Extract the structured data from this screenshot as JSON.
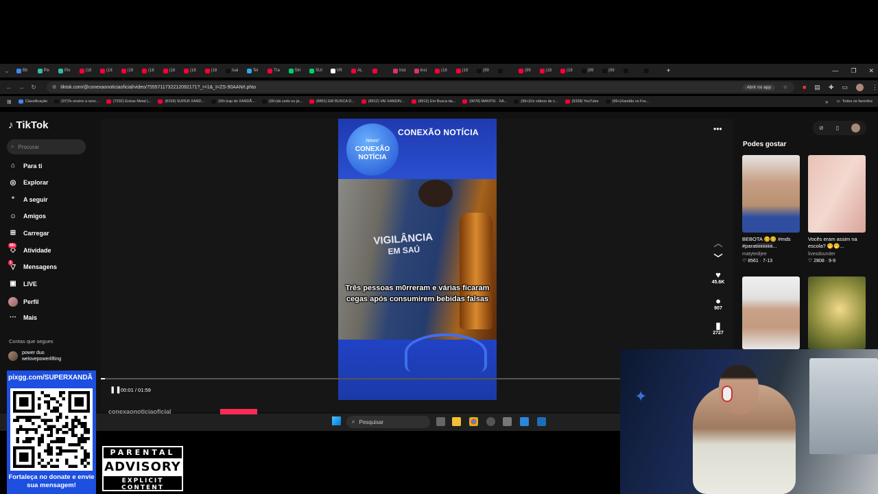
{
  "browser": {
    "tabs": [
      {
        "label": "Bit",
        "color": "#4285f4"
      },
      {
        "label": "Pix",
        "color": "#32bcad"
      },
      {
        "label": "Pix",
        "color": "#32bcad"
      },
      {
        "label": "(18",
        "color": "#ff0033"
      },
      {
        "label": "(18",
        "color": "#ff0033"
      },
      {
        "label": "(18",
        "color": "#ff0033"
      },
      {
        "label": "(18",
        "color": "#ff0033"
      },
      {
        "label": "(18",
        "color": "#ff0033"
      },
      {
        "label": "(18",
        "color": "#ff0033"
      },
      {
        "label": "(18",
        "color": "#ff0033"
      },
      {
        "label": "Isai",
        "color": "#111111"
      },
      {
        "label": "Tel",
        "color": "#2aabee"
      },
      {
        "label": "Tra",
        "color": "#ff0033"
      },
      {
        "label": "Stri",
        "color": "#00d26a"
      },
      {
        "label": "SUI",
        "color": "#00d26a"
      },
      {
        "label": "VR",
        "color": "#ffffff"
      },
      {
        "label": "AL",
        "color": "#ff0033"
      },
      {
        "label": "",
        "color": "#ff0033"
      },
      {
        "label": "Inst",
        "color": "#e1306c"
      },
      {
        "label": "Inst",
        "color": "#e1306c"
      },
      {
        "label": "(18",
        "color": "#ff0033"
      },
      {
        "label": "(18",
        "color": "#ff0033"
      },
      {
        "label": "(99",
        "color": "#111111"
      },
      {
        "label": "",
        "color": "#111111"
      },
      {
        "label": "(99",
        "color": "#ff0033"
      },
      {
        "label": "(18",
        "color": "#ff0033"
      },
      {
        "label": "(18",
        "color": "#ff0033"
      },
      {
        "label": "(99",
        "color": "#111111"
      },
      {
        "label": "(99",
        "color": "#111111"
      },
      {
        "label": "",
        "color": "#111111"
      },
      {
        "label": "",
        "color": "#111111"
      }
    ],
    "url": "tiktok.com/@conexaonoticiaoficial/video/7555711732212092171?_r=1&_t=ZS-90AANrl.phto",
    "open_app": "Abrir no app",
    "bookmarks": [
      {
        "label": "Classificação",
        "color": "#4285f4"
      },
      {
        "label": "(97)Te ensino a venc...",
        "color": "#111111"
      },
      {
        "label": "(7292) Enéas Metal |...",
        "color": "#ff0033"
      },
      {
        "label": "(8159) SUPER XAND...",
        "color": "#ff0033"
      },
      {
        "label": "(99+)rap do XANDÃ...",
        "color": "#111111"
      },
      {
        "label": "(99+)tá cedo ou já...",
        "color": "#111111"
      },
      {
        "label": "(8851) EM BUSCA D...",
        "color": "#ff0033"
      },
      {
        "label": "(8912) VAI XANDIN...",
        "color": "#ff0033"
      },
      {
        "label": "(8912) Em Busca da...",
        "color": "#ff0033"
      },
      {
        "label": "(9078) MANTIS · XA...",
        "color": "#ff0033"
      },
      {
        "label": "(99+)Os vídeos de c...",
        "color": "#111111"
      },
      {
        "label": "(9338) YouTube",
        "color": "#ff0033"
      },
      {
        "label": "(99+)Xandão vs Fra...",
        "color": "#111111"
      }
    ],
    "all_favorites": "Todos os favoritos"
  },
  "tiktok": {
    "brand": "TikTok",
    "search_placeholder": "Procurar",
    "nav": [
      {
        "label": "Para ti",
        "icon": "home-icon"
      },
      {
        "label": "Explorar",
        "icon": "compass-icon"
      },
      {
        "label": "A seguir",
        "icon": "person-plus-icon"
      },
      {
        "label": "Amigos",
        "icon": "friends-icon"
      },
      {
        "label": "Carregar",
        "icon": "upload-icon"
      },
      {
        "label": "Atividade",
        "icon": "activity-icon",
        "badge": "99+"
      },
      {
        "label": "Mensagens",
        "icon": "message-icon",
        "badge": "1"
      },
      {
        "label": "LIVE",
        "icon": "live-icon"
      },
      {
        "label": "Perfil",
        "icon": "avatar"
      },
      {
        "label": "Mais",
        "icon": "more-icon"
      }
    ],
    "following_title": "Contas que segues",
    "following": [
      {
        "name": "power duo",
        "handle": "welovepowerlifting"
      }
    ],
    "video": {
      "header_title": "CONEXÃO NOTÍCIA",
      "logo_tag": "News!",
      "logo_line1": "CONEXÃO",
      "logo_line2": "NOTÍCIA",
      "vest_text_1": "VIGILÂNCIA",
      "vest_text_2": "EM SAÚ",
      "caption": "Três pessoas m0rreram e várias ficaram cegas após consumirem bebidas falsas",
      "time": "00:01 / 01:59",
      "progress": 0.0084,
      "owner": "conexaonoticiaoficial"
    },
    "actions": {
      "likes": "45.6K",
      "comments": "907",
      "saves": "2727"
    },
    "suggestions_title": "Podes gostar",
    "suggestions": [
      {
        "title": "BEBOTA 🥴🥴 #mds #paratiiiiiiiiiiiiii...",
        "user": "matytedijee",
        "likes": "8561",
        "date": "7-13"
      },
      {
        "title": "Vocês eram assim na escola? 🤭🤭...",
        "user": "livesdounder",
        "likes": "2808",
        "date": "9-9"
      },
      {
        "title": "",
        "user": "",
        "likes": "",
        "date": ""
      },
      {
        "title": "",
        "user": "",
        "likes": "",
        "date": ""
      }
    ]
  },
  "taskbar": {
    "search_placeholder": "Pesquisar"
  },
  "overlay": {
    "donate_url": "pixgg.com/SUPERXANDÃ",
    "donate_text": "Fortaleça no donate e envie sua mensagem!",
    "advisory_top": "PARENTAL",
    "advisory_mid": "ADVISORY",
    "advisory_bottom": "EXPLICIT CONTENT"
  },
  "colors": {
    "tiktok_red": "#fe2c55",
    "donate_blue": "#1d4fe0",
    "video_blue": "#1a3ea8"
  }
}
